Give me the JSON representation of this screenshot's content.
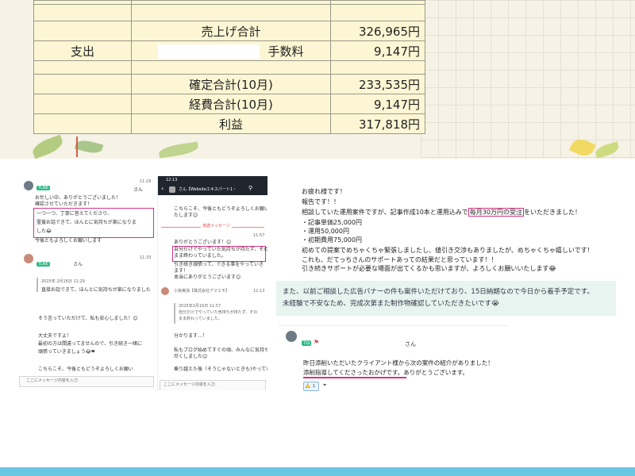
{
  "sheet": {
    "rows": [
      {
        "label": "",
        "item": "",
        "amount": ""
      },
      {
        "label": "",
        "item": "",
        "amount": ""
      },
      {
        "label": "",
        "item": "売上げ合計",
        "amount": "326,965円"
      },
      {
        "label": "支出",
        "item": "手数料",
        "amount": "9,147円"
      },
      {
        "label": "",
        "item": "",
        "amount": ""
      },
      {
        "label": "",
        "item": "確定合計(10月)",
        "amount": "233,535円"
      },
      {
        "label": "",
        "item": "経費合計(10月)",
        "amount": "9,147円"
      },
      {
        "label": "",
        "item": "利益",
        "amount": "317,818円"
      }
    ]
  },
  "chat1": {
    "time1": "11:29",
    "tag1": "TLNE",
    "name1": "さん",
    "msg1": [
      "お忙しい中、ありがとうございました！",
      "確認させていただきます！"
    ],
    "msg1_boxed": [
      "一つ一つ、丁寧に答えてくださり、",
      "霊援お話できて、ほんとに気持ちが楽になりま",
      "した😂"
    ],
    "msg1_tail": "今後ともよろしくお願いします",
    "time2": "11:33",
    "tag2": "TLNE",
    "name2": "さん",
    "quote_meta": "2025年 2月16日 11:29",
    "quote_text": "直接お話できて、ほんとに気持ちが楽になりました",
    "msg2": [
      "そう言っていただけて、私も安心しました！😊"
    ],
    "msg3": [
      "大丈夫ですよ！",
      "最初の方は間違ってませんので、引き続き一緒に",
      "頑張っていきましょう😂❤"
    ],
    "msg4": "こちらこそ、今後ともどうぞよろしくお願い",
    "input_placeholder": "ここにメッセージ内容を入力"
  },
  "chat2": {
    "status_time": "12:13",
    "title": "さん【Websiteエキスパート1・",
    "msg1": [
      "こちらこそ、今後ともどうぞよろしくお願いい",
      "たします😊"
    ],
    "divider": "未読メッセージ",
    "time": "11:57",
    "msg2_head": "ありがとうございます！😊",
    "msg2_boxed": [
      "自分だけでやっていた気持ちが持たず、その",
      "まま終わっていました。"
    ],
    "msg2_tail": [
      "引き続き頑張って、できる事をやっていき",
      "ます！",
      "本当にありがとうございます😊"
    ],
    "sender": "小坂美加【株式会社アマエモ】",
    "time3": "12:13",
    "quote_meta": "2025年2月16日 11:57",
    "quote_text": [
      "自分だけでやっていた気持ちが持たず、その",
      "まま終わっていました。"
    ],
    "msg3": "分かります…！",
    "msg4": [
      "私もブログ始めてすぐの頃、みんなに気持ちを",
      "尽くしました😊"
    ],
    "msg5": "乗り越えた後（そうじゃないときも)やっていきましょう",
    "input_placeholder": "ここにメッセージ内容を入力"
  },
  "report": {
    "lines": [
      "お疲れ様です！",
      "報告です！！",
      "相談していた運用案件ですが、記事作成10本と運用込みで",
      "・記事単価25,000円",
      "・運用50,000円",
      "・初期費用75,000円",
      "初めての提案でめちゃくちゃ緊張しましたし、値引き交渉もありましたが、めちゃくちゃ嬉しいです！",
      "これも、だてっちさんのサポートあっての結果だと思っています！！",
      "引き続きサポートが必要な場面が出てくるかも思いますが、よろしくお願いいたします😂"
    ],
    "boxed": "毎月30万円の受注",
    "line3_tail": "をいただきました！"
  },
  "banner": {
    "line1": "また、以前ご相談した広告バナーの件も案件いただけており、15日納期なので今日から着手予定です。",
    "line2": "未経験で不安なため、完成次第また制作物確認していただきたいです😭"
  },
  "client": {
    "tag": "TO",
    "name": "さん",
    "line1": "昨日添削いただいたクライアント様から次の案件の紹介がありました！",
    "line2": "添削指導してくださったおかげです。ありがとうございます。",
    "reaction_count": "1",
    "reaction_icon": "🙏",
    "add_reaction": "❤"
  },
  "colors": {
    "sheet_bg": "#fdf6d4",
    "pink": "#d63384",
    "green_tag": "#2dbb85",
    "teal_bg": "#e7f4ef",
    "bottom_bar": "#69c7e3"
  }
}
